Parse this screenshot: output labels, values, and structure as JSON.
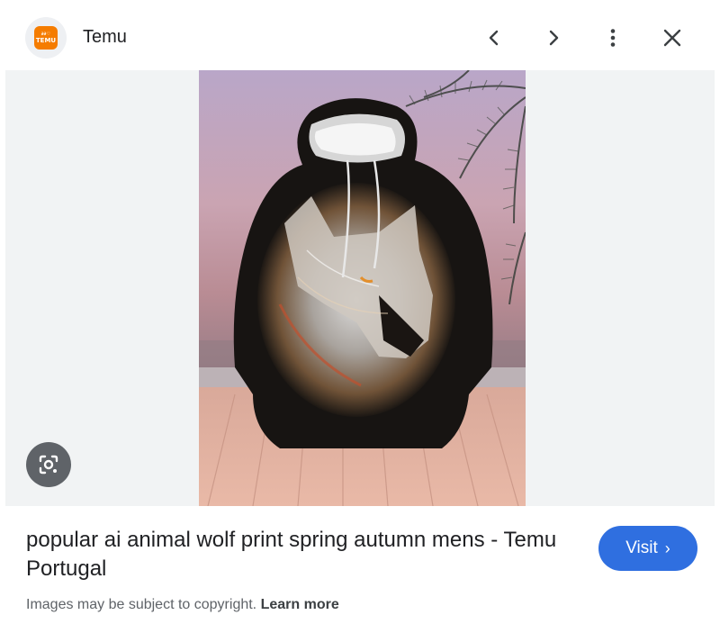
{
  "header": {
    "site_name": "Temu",
    "logo_top_text": "∂ ∂ ♡ ♡",
    "logo_text": "TEMU",
    "prev_icon": "chevron-left-icon",
    "next_icon": "chevron-right-icon",
    "more_icon": "more-vert-icon",
    "close_icon": "close-icon"
  },
  "image": {
    "subject": "wolf print hoodie"
  },
  "caption": {
    "title": "popular ai animal wolf print spring autumn mens - Temu Portugal"
  },
  "visit": {
    "label": "Visit",
    "chevron": "›"
  },
  "footer": {
    "notice": "Images may be subject to copyright.",
    "learn_more": "Learn more"
  },
  "colors": {
    "accent": "#2f6fe0",
    "brand": "#f57c00"
  }
}
